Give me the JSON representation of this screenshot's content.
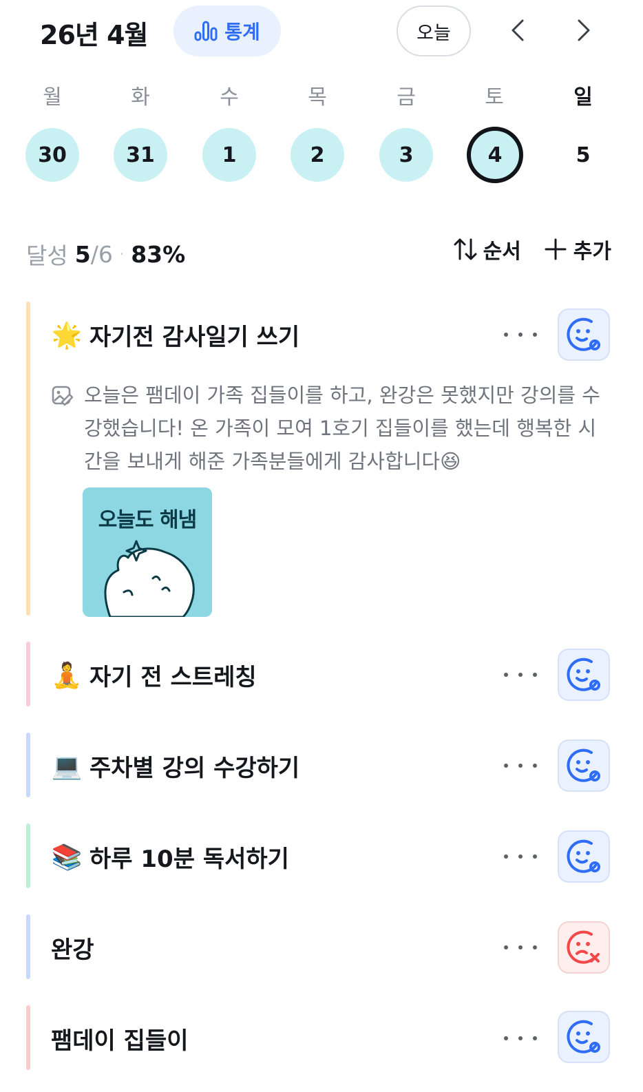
{
  "header": {
    "month_title": "26년 4월",
    "stats_label": "통계",
    "today_label": "오늘",
    "prev_icon": "chevron-left-icon",
    "next_icon": "chevron-right-icon"
  },
  "week": {
    "weekdays": [
      "월",
      "화",
      "수",
      "목",
      "금",
      "토",
      "일"
    ],
    "days": [
      {
        "label": "30",
        "state": "done"
      },
      {
        "label": "31",
        "state": "done"
      },
      {
        "label": "1",
        "state": "done"
      },
      {
        "label": "2",
        "state": "done"
      },
      {
        "label": "3",
        "state": "done"
      },
      {
        "label": "4",
        "state": "selected"
      },
      {
        "label": "5",
        "state": "empty"
      }
    ]
  },
  "summary": {
    "label": "달성",
    "done": "5",
    "total": "/6",
    "dot": "·",
    "percent": "83%",
    "sort_label": "순서",
    "add_label": "추가"
  },
  "habits": [
    {
      "emoji": "🌟",
      "title": "자기전 감사일기 쓰기",
      "color": "#fde0b4",
      "status": "done",
      "memo": "오늘은 팸데이 가족 집들이를 하고, 완강은 못했지만 강의를 수강했습니다! 온 가족이 모여 1호기 집들이를 했는데 행복한 시간을 보내게 해준 가족분들에게 감사합니다😆",
      "sticker_text": "오늘도 해냄"
    },
    {
      "emoji": "🧘",
      "title": "자기 전 스트레칭",
      "color": "#fbc9dc",
      "status": "done"
    },
    {
      "emoji": "💻",
      "title": "주차별 강의 수강하기",
      "color": "#c8d9fb",
      "status": "done"
    },
    {
      "emoji": "📚",
      "title": "하루 10분 독서하기",
      "color": "#bfeed4",
      "status": "done"
    },
    {
      "emoji": "",
      "title": "완강",
      "color": "#c8d9fb",
      "status": "fail"
    },
    {
      "emoji": "",
      "title": "팸데이 집들이",
      "color": "#fbcaca",
      "status": "done"
    }
  ],
  "colors": {
    "accent": "#2f6df6",
    "done_day": "#c9f1f4",
    "fail": "#f24848"
  }
}
